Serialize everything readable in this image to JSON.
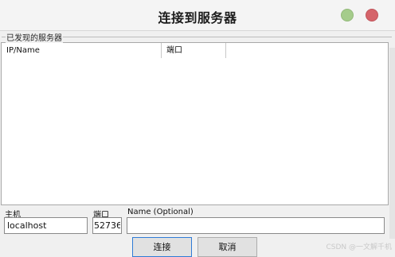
{
  "window": {
    "title": "连接到服务器"
  },
  "discovered": {
    "legend": "已发现的服务器",
    "columns": [
      "IP/Name",
      "端口"
    ],
    "rows": []
  },
  "form": {
    "host_label": "主机",
    "host_value": "localhost",
    "port_label": "端口",
    "port_value": "52736",
    "name_label": "Name (Optional)",
    "name_value": ""
  },
  "buttons": {
    "connect": "连接",
    "cancel": "取消"
  },
  "watermark": "CSDN @一文解千机",
  "colors": {
    "minimize": "#a5cc8b",
    "close": "#d5646a",
    "focus_border": "#2f7bd6"
  }
}
